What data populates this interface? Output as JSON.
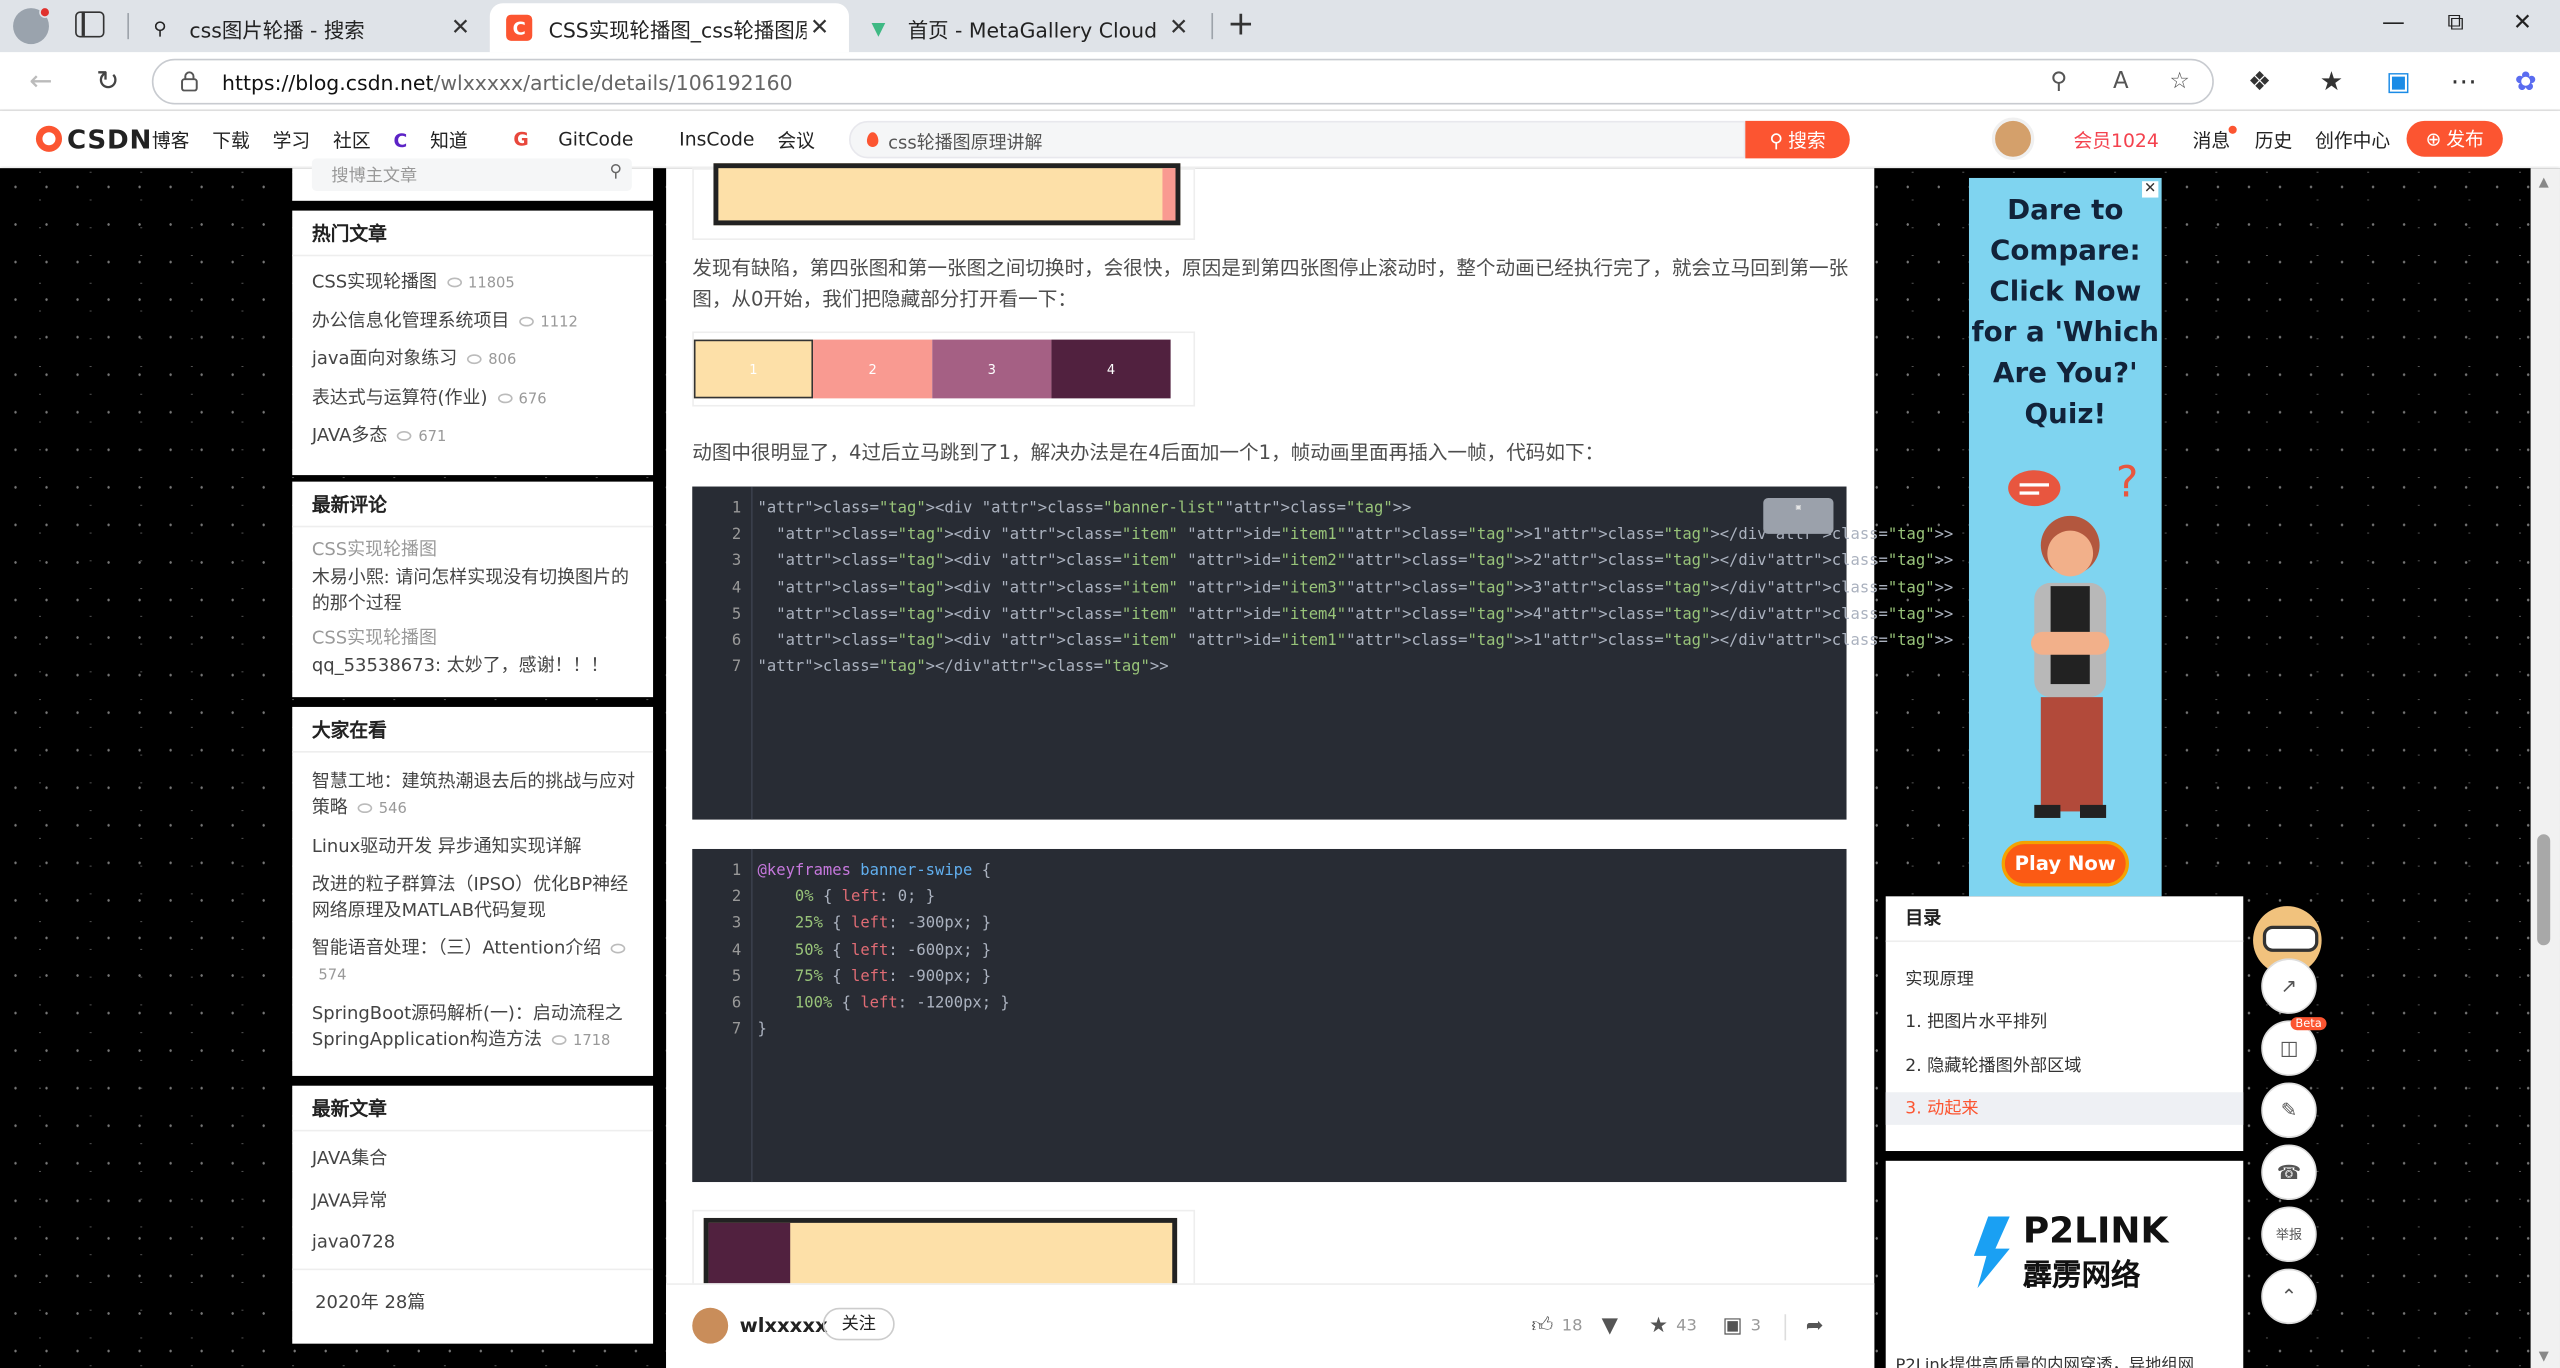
{
  "browser": {
    "tabs": [
      {
        "title": "css图片轮播 - 搜索",
        "icon": "search-icon"
      },
      {
        "title": "CSS实现轮播图_css轮播图原理讲解",
        "icon": "csdn-favicon",
        "active": true
      },
      {
        "title": "首页 - MetaGallery Cloud",
        "icon": "vue-favicon"
      }
    ],
    "url_host": "https://blog.csdn.net",
    "url_rest": "/wlxxxxx/article/details/106192160"
  },
  "csdn_bar": {
    "logo": "CSDN",
    "nav": [
      "博客",
      "下载",
      "学习",
      "社区",
      "知道",
      "GitCode",
      "InsCode",
      "会议"
    ],
    "search_query": "css轮播图原理讲解",
    "search_button": "搜索",
    "member": "会员1024",
    "links": [
      "消息",
      "历史",
      "创作中心"
    ],
    "publish": "发布",
    "accent": "#fc5531"
  },
  "sidebar": {
    "search_placeholder": "搜博主文章",
    "hot": {
      "title": "热门文章",
      "items": [
        {
          "label": "CSS实现轮播图",
          "views": "11805"
        },
        {
          "label": "办公信息化管理系统项目",
          "views": "1112"
        },
        {
          "label": "java面向对象练习",
          "views": "806"
        },
        {
          "label": "表达式与运算符(作业)",
          "views": "676"
        },
        {
          "label": "JAVA多态",
          "views": "671"
        }
      ]
    },
    "comments": {
      "title": "最新评论",
      "items": [
        {
          "article": "CSS实现轮播图",
          "text": "木易小熙: 请问怎样实现没有切换图片的的那个过程"
        },
        {
          "article": "CSS实现轮播图",
          "text": "qq_53538673: 太妙了，感谢！！！"
        }
      ]
    },
    "trending": {
      "title": "大家在看",
      "items": [
        {
          "label": "智慧工地：建筑热潮退去后的挑战与应对策略",
          "views": "546"
        },
        {
          "label": "Linux驱动开发 异步通知实现详解",
          "views": ""
        },
        {
          "label": "改进的粒子群算法（IPSO）优化BP神经网络原理及MATLAB代码复现",
          "views": ""
        },
        {
          "label": "智能语音处理：（三）Attention介绍",
          "views": "574"
        },
        {
          "label": "SpringBoot源码解析(一)：启动流程之SpringApplication构造方法",
          "views": "1718"
        }
      ]
    },
    "latest": {
      "title": "最新文章",
      "items": [
        "JAVA集合",
        "JAVA异常",
        "java0728"
      ],
      "archive": "2020年  28篇"
    }
  },
  "article": {
    "para1": "发现有缺陷，第四张图和第一张图之间切换时，会很快，原因是到第四张图停止滚动时，整个动画已经执行完了，就会立马回到第一张图，从0开始，我们把隐藏部分打开看一下：",
    "demo_blocks": [
      {
        "label": "1",
        "color": "#fde0a8"
      },
      {
        "label": "2",
        "color": "#f99a91"
      },
      {
        "label": "3",
        "color": "#a56084"
      },
      {
        "label": "4",
        "color": "#51213f"
      }
    ],
    "para2": "动图中很明显了，4过后立马跳到了1，解决办法是在4后面加一个1，帧动画里面再插入一帧，代码如下：",
    "code1_lines": [
      "<div class=\"banner-list\">",
      "  <div class=\"item\" id=\"item1\">1</div>",
      "  <div class=\"item\" id=\"item2\">2</div>",
      "  <div class=\"item\" id=\"item3\">3</div>",
      "  <div class=\"item\" id=\"item4\">4</div>",
      "  <div class=\"item\" id=\"item1\">1</div>",
      "</div>"
    ],
    "code2_lines": [
      "@keyframes banner-swipe {",
      "    0% { left: 0; }",
      "    25% { left: -300px; }",
      "    50% { left: -600px; }",
      "    75% { left: -900px; }",
      "    100% { left: -1200px; }",
      "}"
    ]
  },
  "author_bar": {
    "name": "wlxxxxx",
    "follow": "关注",
    "likes": "18",
    "stars": "43",
    "comments": "3"
  },
  "right": {
    "ad_text": "Dare to Compare: Click Now for a 'Which Are You?' Quiz!",
    "ad_button": "Play Now",
    "toc_title": "目录",
    "toc_items": [
      "实现原理",
      "1. 把图片水平排列",
      "2. 隐藏轮播图外部区域",
      "3. 动起来"
    ],
    "ad2_brand": "P2LINK",
    "ad2_brand_cn": "霹雳网络",
    "ad2_text": "P2Link提供高质量的内网穿透，异地组网",
    "float_beta": "Beta",
    "float_report": "举报"
  }
}
